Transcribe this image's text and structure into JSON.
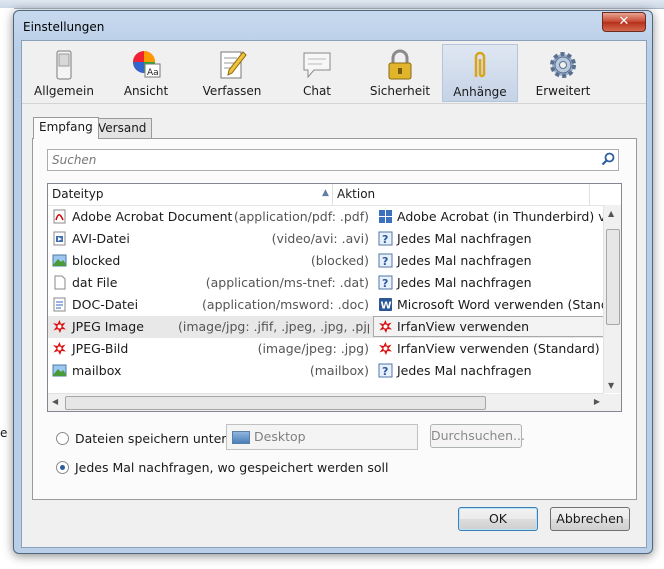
{
  "window": {
    "title": "Einstellungen",
    "close_glyph": "✕"
  },
  "toolbar": {
    "items": [
      {
        "label": "Allgemein",
        "icon": "switch-icon"
      },
      {
        "label": "Ansicht",
        "icon": "color-wheel-icon"
      },
      {
        "label": "Verfassen",
        "icon": "compose-icon"
      },
      {
        "label": "Chat",
        "icon": "chat-bubble-icon"
      },
      {
        "label": "Sicherheit",
        "icon": "padlock-icon"
      },
      {
        "label": "Anhänge",
        "icon": "paperclip-icon",
        "selected": true
      },
      {
        "label": "Erweitert",
        "icon": "gear-icon"
      }
    ]
  },
  "tabs": {
    "items": [
      "Empfang",
      "Versand"
    ],
    "active": "Empfang"
  },
  "search": {
    "placeholder": "Suchen"
  },
  "list": {
    "columns": [
      "Dateityp",
      "Aktion"
    ],
    "rows": [
      {
        "name": "Adobe Acrobat Document",
        "mime": "(application/pdf: .pdf)",
        "action": "Adobe Acrobat (in Thunderbird) ve",
        "ficon": "pdf-icon",
        "aicon": "plugin-icon"
      },
      {
        "name": "AVI-Datei",
        "mime": "(video/avi: .avi)",
        "action": "Jedes Mal nachfragen",
        "ficon": "video-file-icon",
        "aicon": "question-icon"
      },
      {
        "name": "blocked",
        "mime": "(blocked)",
        "action": "Jedes Mal nachfragen",
        "ficon": "image-file-icon",
        "aicon": "question-icon"
      },
      {
        "name": "dat File",
        "mime": "(application/ms-tnef: .dat)",
        "action": "Jedes Mal nachfragen",
        "ficon": "blank-file-icon",
        "aicon": "question-icon"
      },
      {
        "name": "DOC-Datei",
        "mime": "(application/msword: .doc)",
        "action": "Microsoft Word verwenden (Standa",
        "ficon": "doc-file-icon",
        "aicon": "word-icon"
      },
      {
        "name": "JPEG Image",
        "mime": "(image/jpg: .jfif, .jpeg, .jpg, .pjp, .pjp...",
        "action": "IrfanView verwenden",
        "ficon": "irfanview-icon",
        "aicon": "irfanview-icon",
        "selected": true
      },
      {
        "name": "JPEG-Bild",
        "mime": "(image/jpeg: .jpg)",
        "action": "IrfanView verwenden (Standard)",
        "ficon": "irfanview-icon",
        "aicon": "irfanview-icon"
      },
      {
        "name": "mailbox",
        "mime": "(mailbox)",
        "action": "Jedes Mal nachfragen",
        "ficon": "image-file-icon",
        "aicon": "question-icon"
      }
    ]
  },
  "save": {
    "option_save_to": "Dateien speichern unter",
    "folder": "Desktop",
    "browse_label": "Durchsuchen...",
    "option_ask": "Jedes Mal nachfragen, wo gespeichert werden soll",
    "selected_option": "ask"
  },
  "footer": {
    "ok_label": "OK",
    "cancel_label": "Abbrechen"
  },
  "background": {
    "side_char": "e"
  }
}
